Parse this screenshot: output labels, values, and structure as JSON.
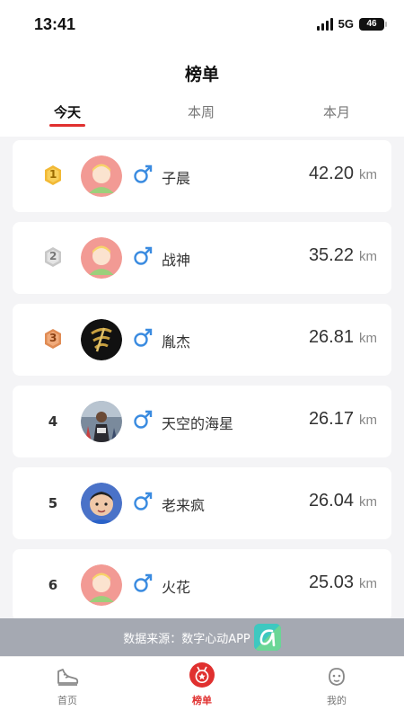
{
  "status": {
    "time": "13:41",
    "network": "5G",
    "battery": "46"
  },
  "header": {
    "title": "榜单"
  },
  "tabs": [
    {
      "label": "今天",
      "active": true
    },
    {
      "label": "本周",
      "active": false
    },
    {
      "label": "本月",
      "active": false
    }
  ],
  "rankings": [
    {
      "rank": "1",
      "name": "子晨",
      "distance": "42.20",
      "unit": "km",
      "gender": "male",
      "avatar": "default-avatar"
    },
    {
      "rank": "2",
      "name": "战神",
      "distance": "35.22",
      "unit": "km",
      "gender": "male",
      "avatar": "default-avatar"
    },
    {
      "rank": "3",
      "name": "胤杰",
      "distance": "26.81",
      "unit": "km",
      "gender": "male",
      "avatar": "logo-avatar"
    },
    {
      "rank": "4",
      "name": "天空的海星",
      "distance": "26.17",
      "unit": "km",
      "gender": "male",
      "avatar": "photo-avatar"
    },
    {
      "rank": "5",
      "name": "老来疯",
      "distance": "26.04",
      "unit": "km",
      "gender": "male",
      "avatar": "photo-avatar"
    },
    {
      "rank": "6",
      "name": "火花",
      "distance": "25.03",
      "unit": "km",
      "gender": "male",
      "avatar": "default-avatar"
    }
  ],
  "source": {
    "label": "数据来源：数字心动APP",
    "logo_letter": "a"
  },
  "tabbar": [
    {
      "label": "首页",
      "icon": "shoe-icon",
      "active": false
    },
    {
      "label": "榜单",
      "icon": "medal-icon",
      "active": true
    },
    {
      "label": "我的",
      "icon": "face-icon",
      "active": false
    }
  ],
  "colors": {
    "accent": "#e0302f",
    "gold": "#f2b935",
    "silver": "#c8c8c8",
    "bronze": "#e08c55",
    "male": "#3a8be0"
  }
}
